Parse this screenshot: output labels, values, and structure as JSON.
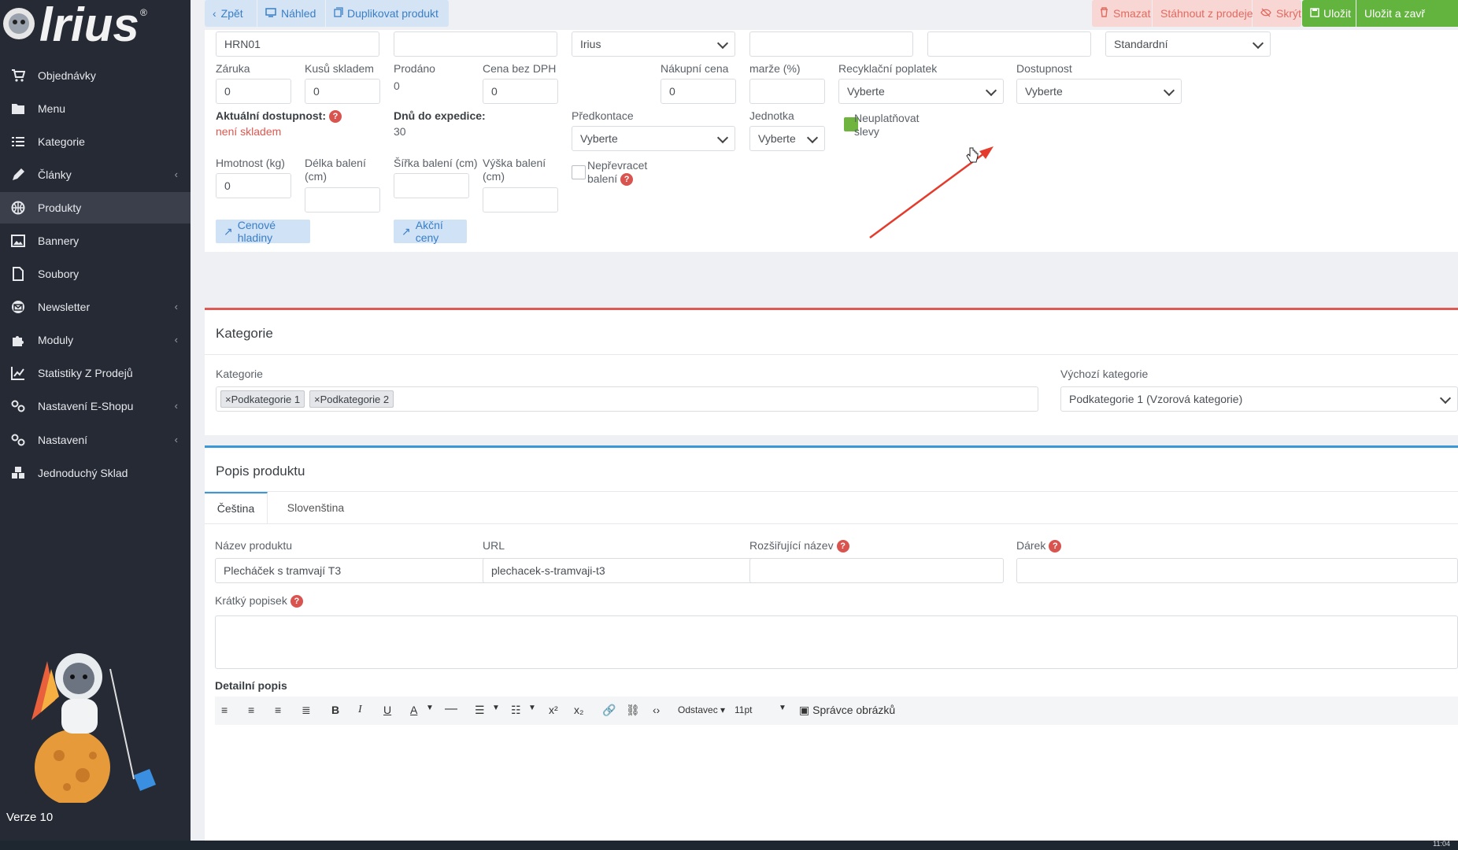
{
  "sidebar": {
    "brand": "Irius",
    "items": [
      {
        "label": "Objednávky",
        "icon": "cart-icon",
        "arrow": false
      },
      {
        "label": "Menu",
        "icon": "folder-icon",
        "arrow": false
      },
      {
        "label": "Kategorie",
        "icon": "list-icon",
        "arrow": false
      },
      {
        "label": "Články",
        "icon": "pencil-icon",
        "arrow": true
      },
      {
        "label": "Produkty",
        "icon": "basketball-icon",
        "arrow": false,
        "active": true
      },
      {
        "label": "Bannery",
        "icon": "image-icon",
        "arrow": false
      },
      {
        "label": "Soubory",
        "icon": "file-icon",
        "arrow": false
      },
      {
        "label": "Newsletter",
        "icon": "envelope-icon",
        "arrow": true
      },
      {
        "label": "Moduly",
        "icon": "puzzle-icon",
        "arrow": true
      },
      {
        "label": "Statistiky Z Prodejů",
        "icon": "chart-icon",
        "arrow": false
      },
      {
        "label": "Nastavení E-Shopu",
        "icon": "settings-icon",
        "arrow": true
      },
      {
        "label": "Nastavení",
        "icon": "settings-icon",
        "arrow": true
      },
      {
        "label": "Jednoduchý Sklad",
        "icon": "boxes-icon",
        "arrow": false
      }
    ],
    "version": "Verze 10"
  },
  "toolbar": {
    "back": "Zpět",
    "preview": "Náhled",
    "duplicate": "Duplikovat produkt",
    "delete": "Smazat",
    "withdraw": "Stáhnout z prodeje",
    "hide": "Skrýt",
    "save": "Uložit",
    "save_close": "Uložit a zavř"
  },
  "form": {
    "row0": {
      "code": "HRN01",
      "field2": "",
      "brand": "Irius",
      "field4": "",
      "field5": "",
      "template": "Standardní"
    },
    "warranty": {
      "label": "Záruka",
      "value": "0"
    },
    "stock": {
      "label": "Kusů skladem",
      "value": "0"
    },
    "sold": {
      "label": "Prodáno",
      "value": "0"
    },
    "price": {
      "label": "Cena bez DPH",
      "value": "0"
    },
    "purchase": {
      "label": "Nákupní cena",
      "value": "0"
    },
    "margin": {
      "label": "marže (%)",
      "value": ""
    },
    "recycling": {
      "label": "Recyklační poplatek",
      "value": "Vyberte"
    },
    "availability": {
      "label": "Dostupnost",
      "value": "Vyberte"
    },
    "current_avail": {
      "label": "Aktuální dostupnost:",
      "value": "není skladem"
    },
    "days": {
      "label": "Dnů do expedice:",
      "value": "30"
    },
    "precontact": {
      "label": "Předkontace",
      "value": "Vyberte"
    },
    "unit": {
      "label": "Jednotka",
      "value": "Vyberte"
    },
    "no_discount": {
      "label_1": "Neuplatňovat",
      "label_2": "slevy"
    },
    "weight": {
      "label": "Hmotnost (kg)",
      "value": "0"
    },
    "length": {
      "label_1": "Délka balení",
      "label_2": "(cm)",
      "value": ""
    },
    "width": {
      "label": "Šířka balení (cm)",
      "value": ""
    },
    "height": {
      "label_1": "Výška balení",
      "label_2": "(cm)",
      "value": ""
    },
    "no_repack": {
      "label_1": "Nepřevracet",
      "label_2": "balení"
    },
    "price_levels": "Cenové hladiny",
    "action_prices": "Akční ceny"
  },
  "category": {
    "title": "Kategorie",
    "label": "Kategorie",
    "tags": [
      "Podkategorie 1",
      "Podkategorie 2"
    ],
    "default_label": "Výchozí kategorie",
    "default_value": "Podkategorie 1 (Vzorová kategorie)"
  },
  "description": {
    "title": "Popis produktu",
    "tabs": [
      "Čeština",
      "Slovenština"
    ],
    "name_label": "Název produktu",
    "name_value": "Plecháček s tramvají T3",
    "url_label": "URL",
    "url_value": "plechacek-s-tramvaji-t3",
    "ext_label": "Rozšiřující název",
    "gift_label": "Dárek",
    "short_label": "Krátký popisek",
    "detail_label": "Detailní popis",
    "paragraph": "Odstavec",
    "fontsize": "11pt",
    "image_manager": "Správce obrázků"
  },
  "clock": "11:04",
  "colors": {
    "sidebar": "#262a34",
    "accent_blue": "#3a7ec6",
    "danger": "#d9534f",
    "success": "#63b33f"
  }
}
